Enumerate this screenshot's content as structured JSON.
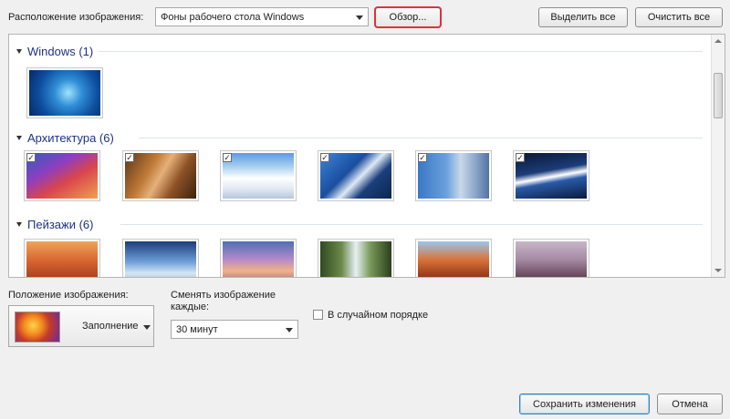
{
  "top": {
    "location_label": "Расположение изображения:",
    "location_value": "Фоны рабочего стола Windows",
    "browse_label": "Обзор...",
    "select_all_label": "Выделить все",
    "clear_all_label": "Очистить все"
  },
  "groups": [
    {
      "title": "Windows (1)"
    },
    {
      "title": "Архитектура (6)"
    },
    {
      "title": "Пейзажи (6)"
    }
  ],
  "thumbs": {
    "check_mark": "✓"
  },
  "bottom": {
    "position_label": "Положение изображения:",
    "position_value": "Заполнение",
    "change_label_line1": "Сменять изображение",
    "change_label_line2": "каждые:",
    "interval_value": "30 минут",
    "shuffle_label": "В случайном порядке",
    "save_label": "Сохранить изменения",
    "cancel_label": "Отмена"
  },
  "colors": {
    "accent_highlight": "#e0303c",
    "group_title": "#1e3287"
  }
}
